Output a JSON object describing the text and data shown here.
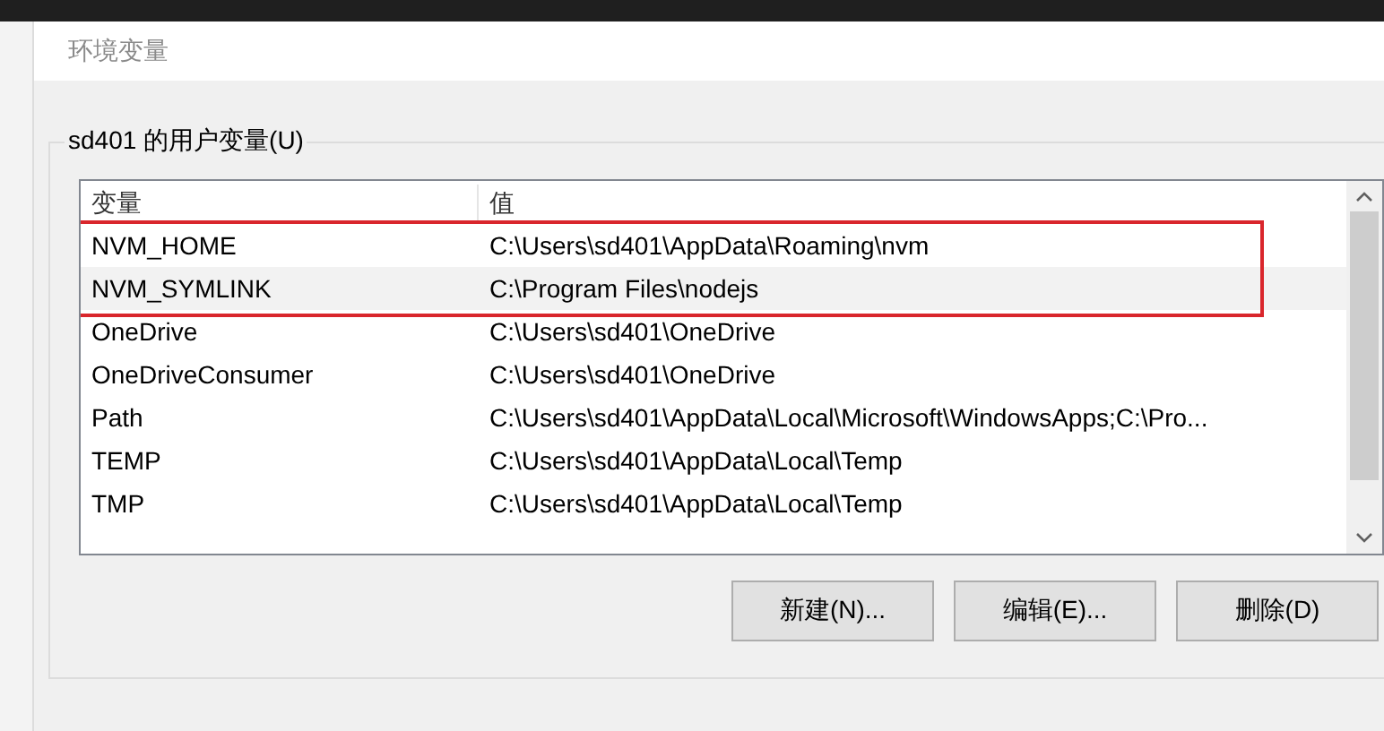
{
  "window": {
    "title": "环境变量"
  },
  "user_variables": {
    "title": "sd401 的用户变量(U)",
    "columns": [
      "变量",
      "值"
    ],
    "rows": [
      {
        "name": "NVM_HOME",
        "value": "C:\\Users\\sd401\\AppData\\Roaming\\nvm",
        "selected": false,
        "annotated": true
      },
      {
        "name": "NVM_SYMLINK",
        "value": "C:\\Program Files\\nodejs",
        "selected": true,
        "annotated": true
      },
      {
        "name": "OneDrive",
        "value": "C:\\Users\\sd401\\OneDrive",
        "selected": false,
        "annotated": false
      },
      {
        "name": "OneDriveConsumer",
        "value": "C:\\Users\\sd401\\OneDrive",
        "selected": false,
        "annotated": false
      },
      {
        "name": "Path",
        "value": "C:\\Users\\sd401\\AppData\\Local\\Microsoft\\WindowsApps;C:\\Pro...",
        "selected": false,
        "annotated": false
      },
      {
        "name": "TEMP",
        "value": "C:\\Users\\sd401\\AppData\\Local\\Temp",
        "selected": false,
        "annotated": false
      },
      {
        "name": "TMP",
        "value": "C:\\Users\\sd401\\AppData\\Local\\Temp",
        "selected": false,
        "annotated": false
      }
    ],
    "buttons": [
      "新建(N)...",
      "编辑(E)...",
      "删除(D)"
    ]
  }
}
